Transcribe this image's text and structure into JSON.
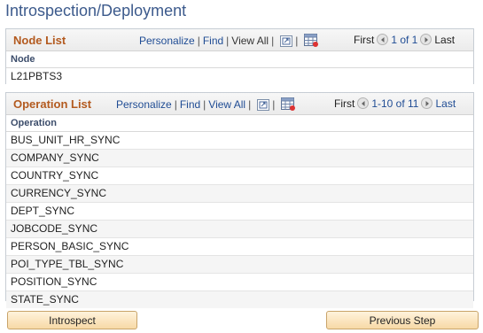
{
  "page": {
    "title": "Introspection/Deployment"
  },
  "node_list": {
    "title": "Node List",
    "personalize": "Personalize",
    "find": "Find",
    "view_all": "View All",
    "first": "First",
    "range": "1 of 1",
    "last": "Last",
    "column": "Node",
    "rows": [
      "L21PBTS3"
    ]
  },
  "operation_list": {
    "title": "Operation List",
    "personalize": "Personalize",
    "find": "Find",
    "view_all": "View All",
    "first": "First",
    "range": "1-10 of 11",
    "last": "Last",
    "column": "Operation",
    "rows": [
      "BUS_UNIT_HR_SYNC",
      "COMPANY_SYNC",
      "COUNTRY_SYNC",
      "CURRENCY_SYNC",
      "DEPT_SYNC",
      "JOBCODE_SYNC",
      "PERSON_BASIC_SYNC",
      "POI_TYPE_TBL_SYNC",
      "POSITION_SYNC",
      "STATE_SYNC"
    ]
  },
  "buttons": {
    "introspect": "Introspect",
    "previous_step": "Previous Step"
  },
  "colors": {
    "title": "#3c5a8c",
    "grid_title": "#b35a1f",
    "link": "#1f4c94",
    "button_bg": "#f7d9a6"
  },
  "icons": [
    "zoom-icon",
    "download-grid-icon",
    "prev-arrow-icon",
    "next-arrow-icon"
  ]
}
